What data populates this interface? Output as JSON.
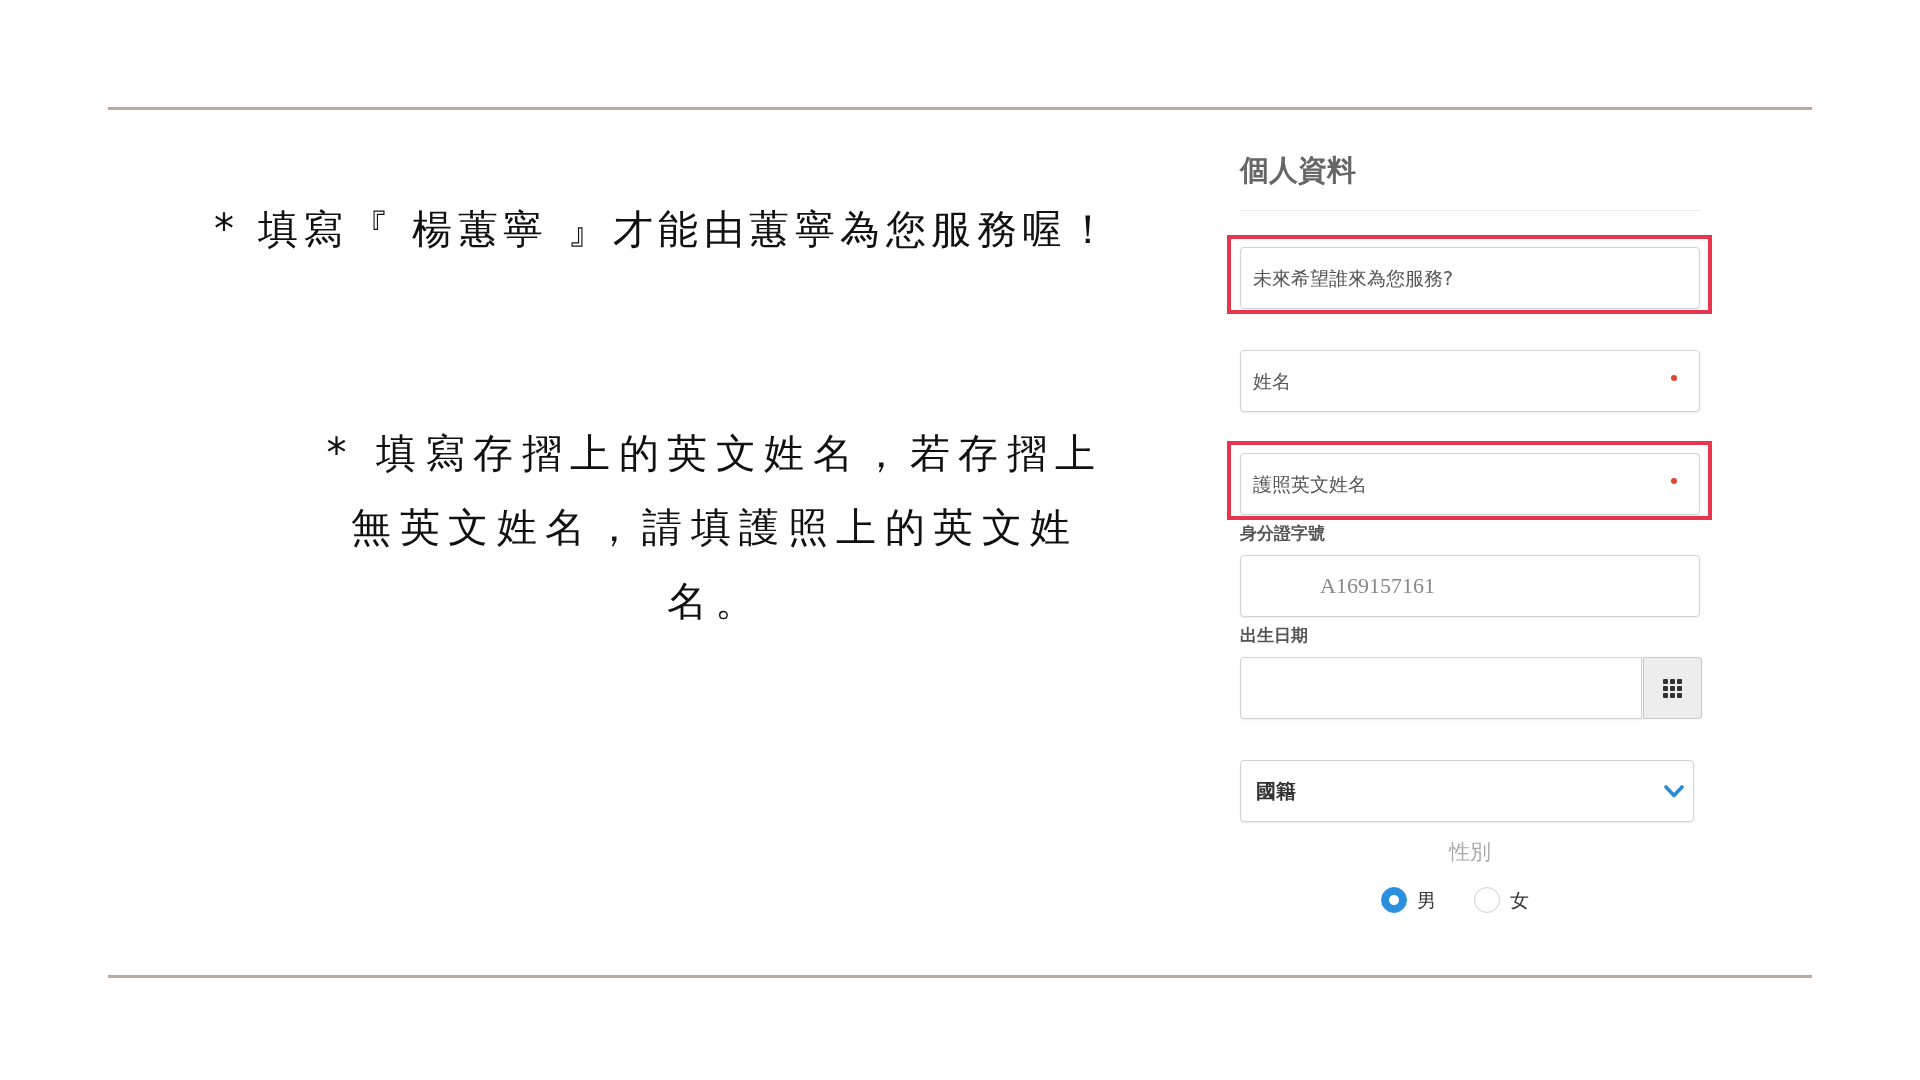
{
  "notes": [
    "* 填寫『 楊蕙寧 』才能由蕙寧為您服務喔！",
    "* 填寫存摺上的英文姓名，若存摺上無英文姓名，請填護照上的英文姓名。"
  ],
  "form": {
    "title": "個人資料",
    "fields": [
      {
        "kind": "text",
        "placeholder": "未來希望誰來為您服務?",
        "required": false,
        "highlighted": true
      },
      {
        "kind": "text",
        "placeholder": "姓名",
        "required": true,
        "highlighted": false
      },
      {
        "kind": "text",
        "placeholder": "護照英文姓名",
        "required": true,
        "highlighted": true
      },
      {
        "kind": "text",
        "label": "身分證字號",
        "value": "A169157161",
        "required": false,
        "highlighted": false
      },
      {
        "kind": "date",
        "label": "出生日期",
        "required": false,
        "highlighted": false
      },
      {
        "kind": "select",
        "value": "國籍",
        "required": false,
        "highlighted": false
      }
    ],
    "gender": {
      "label": "性別",
      "options": [
        {
          "label": "男",
          "selected": true
        },
        {
          "label": "女",
          "selected": false
        }
      ]
    }
  }
}
